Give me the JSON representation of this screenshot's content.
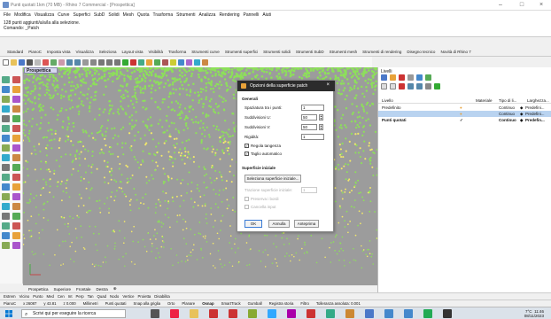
{
  "window": {
    "title": "Punti quotati 1km (70 MB) - Rhino 7 Commercial - [Prospettica]",
    "minimize": "–",
    "maximize": "□",
    "close": "×"
  },
  "menu": [
    "File",
    "Modifica",
    "Visualizza",
    "Curve",
    "Superfici",
    "SubD",
    "Solidi",
    "Mesh",
    "Quota",
    "Trasforma",
    "Strumenti",
    "Analizza",
    "Rendering",
    "Pannelli",
    "Aiuti"
  ],
  "command_history": {
    "line1": "128 punti aggiunti/a/a/la alla selezione.",
    "line2": "Comando: _Patch"
  },
  "toolbar_tabs": [
    "Standard",
    "PianoC",
    "Imposta vista",
    "Visualizza",
    "Seleziona",
    "Layout vista",
    "Visibilità",
    "Trasforma",
    "Strumenti curve",
    "Strumenti superfici",
    "Strumenti solidi",
    "Strumenti SubD",
    "Strumenti mesh",
    "Strumenti di rendering",
    "Disegno tecnico",
    "Novità di Rhino 7"
  ],
  "viewport": {
    "label": "Prospettica",
    "background": "#9c9c9c",
    "point_color_green": "#8de05a",
    "point_color_yellow": "#f2e86a"
  },
  "viewport_tabs": [
    "Prospettica",
    "Superiore",
    "Frontale",
    "Destra"
  ],
  "layers_panel": {
    "title": "Livelli",
    "columns": {
      "name": "Livello",
      "material": "Materiale",
      "linetype": "Tipo di li...",
      "width": "Larghezza..."
    },
    "rows": [
      {
        "name": "Predefinito",
        "linetype": "Continuo",
        "width": "Predefini..."
      },
      {
        "name": "",
        "linetype": "Continuo",
        "width": "Predefini..."
      },
      {
        "name": "Punti quotati",
        "linetype": "Continuo",
        "width": "Predefin..."
      }
    ]
  },
  "dialog": {
    "title": "Opzioni della superficie patch",
    "close": "×",
    "section_general": "Generali",
    "spacing_label": "Spaziatura tra i punti:",
    "spacing_value": "1",
    "u_label": "Suddivisioni U:",
    "u_value": "50",
    "v_label": "Suddivisioni V:",
    "v_value": "50",
    "stiffness_label": "Rigidità:",
    "stiffness_value": "1",
    "tangency_label": "Regola tangenza",
    "tangency_checked": true,
    "autotrim_label": "Taglio automatico",
    "autotrim_checked": true,
    "section_start": "Superficie iniziale",
    "select_start_button": "Seleziona superficie iniziale...",
    "pull_label": "Trazione superficie iniziale:",
    "pull_value": "1",
    "preserve_label": "Preserva i bordi",
    "cancel_input_label": "Cancella input",
    "ok": "OK",
    "cancel": "Annulla",
    "preview": "Anteprima"
  },
  "osnap": [
    "Estrem",
    "Vicino",
    "Punto",
    "Med",
    "Cen",
    "Int",
    "Perp",
    "Tan",
    "Quad",
    "Nodo",
    "Vertice",
    "Proietta",
    "Disabilita"
  ],
  "statusbar": {
    "cplane": "PianoC",
    "x": "x 26087",
    "y": "y 43.81",
    "z": "z 0.000",
    "units": "Millimetri",
    "layer": "Punti quotati",
    "items": [
      "Snap alla griglia",
      "Orto",
      "Planare",
      "Osnap",
      "SmartTrack",
      "Gumball",
      "Registra storia",
      "Filtro",
      "Tolleranza assoluta: 0.001"
    ]
  },
  "taskbar": {
    "search_placeholder": "Scrivi qui per eseguire la ricerca",
    "weather": "7°C",
    "time": "11:46",
    "date": "08/11/2023"
  }
}
